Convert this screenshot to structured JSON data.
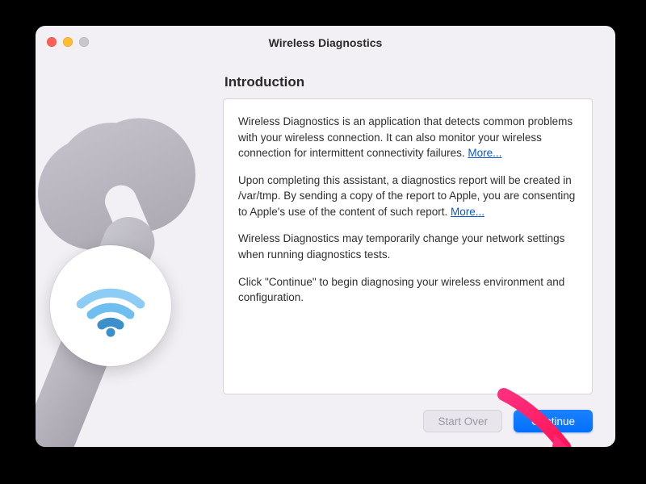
{
  "window": {
    "title": "Wireless Diagnostics"
  },
  "heading": "Introduction",
  "paragraphs": {
    "p1_a": "Wireless Diagnostics is an application that detects common problems with your wireless connection. It can also monitor your wireless connection for intermittent connectivity failures. ",
    "p1_more": "More...",
    "p2_a": "Upon completing this assistant, a diagnostics report will be created in /var/tmp. By sending a copy of the report to Apple, you are consenting to Apple's use of the content of such report. ",
    "p2_more": "More...",
    "p3": "Wireless Diagnostics may temporarily change your network settings when running diagnostics tests.",
    "p4": "Click \"Continue\" to begin diagnosing your wireless environment and configuration."
  },
  "buttons": {
    "start_over": "Start Over",
    "continue": "Continue"
  },
  "icons": {
    "wifi": "wifi-icon",
    "wrench": "wrench-icon"
  }
}
